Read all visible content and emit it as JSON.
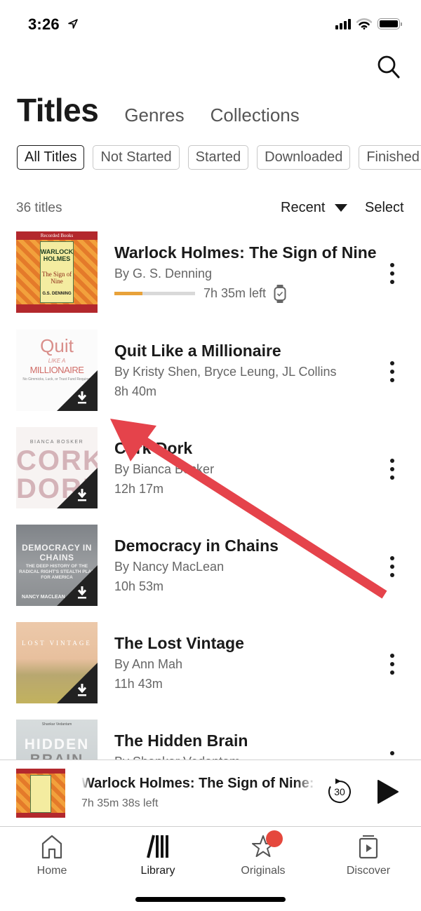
{
  "status_bar": {
    "time": "3:26",
    "icons": [
      "location-arrow-icon",
      "cellular-signal-icon",
      "wifi-icon",
      "battery-icon"
    ]
  },
  "header": {
    "search_icon": "search-icon",
    "tabs": [
      {
        "label": "Titles",
        "active": true
      },
      {
        "label": "Genres",
        "active": false
      },
      {
        "label": "Collections",
        "active": false
      }
    ]
  },
  "filters": [
    {
      "label": "All Titles",
      "active": true
    },
    {
      "label": "Not Started",
      "active": false
    },
    {
      "label": "Started",
      "active": false
    },
    {
      "label": "Downloaded",
      "active": false
    },
    {
      "label": "Finished",
      "active": false
    }
  ],
  "list_meta": {
    "count_label": "36 titles",
    "sort_label": "Recent",
    "select_label": "Select"
  },
  "titles": [
    {
      "title": "Warlock Holmes: The Sign of Nine",
      "author": "By G. S. Denning",
      "progress": 0.35,
      "time_left": "7h 35m left",
      "downloaded": false,
      "watch_synced": true,
      "cover": {
        "publisher": "Recorded Books",
        "line1": "WARLOCK HOLMES",
        "line2": "The Sign of Nine",
        "line3": "G.S. DENNING"
      }
    },
    {
      "title": "Quit Like a Millionaire",
      "author": "By Kristy Shen, Bryce Leung, JL Collins",
      "duration": "8h 40m",
      "downloaded": true,
      "cover": {
        "line1": "Quit",
        "line2": "LIKE A",
        "line3": "MILLIONAIRE",
        "line4": "No Gimmicks, Luck, or Trust Fund Required"
      }
    },
    {
      "title": "Cork Dork",
      "author": "By Bianca Bosker",
      "duration": "12h 17m",
      "downloaded": true,
      "cover": {
        "line1": "BIANCA BOSKER",
        "line2": "CORK DORK"
      }
    },
    {
      "title": "Democracy in Chains",
      "author": "By Nancy MacLean",
      "duration": "10h 53m",
      "downloaded": true,
      "cover": {
        "line1": "DEMOCRACY IN CHAINS",
        "line2": "THE DEEP HISTORY OF THE RADICAL RIGHT'S STEALTH PLAN FOR AMERICA",
        "line3": "NANCY MACLEAN"
      }
    },
    {
      "title": "The Lost Vintage",
      "author": "By Ann Mah",
      "duration": "11h 43m",
      "downloaded": true,
      "cover": {
        "line1": "LOST VINTAGE"
      }
    },
    {
      "title": "The Hidden Brain",
      "author": "By Shankar Vedantam",
      "duration": "",
      "downloaded": false,
      "cover": {
        "line0": "Shankar Vedantam",
        "line1": "HIDDEN",
        "line2": "BRAIN"
      }
    }
  ],
  "mini_player": {
    "title": "Warlock Holmes: The Sign of Nine: Wa",
    "time_left": "7h 35m 38s left",
    "skip_back_seconds": "30"
  },
  "tab_bar": [
    {
      "label": "Home",
      "icon": "home-icon",
      "active": false
    },
    {
      "label": "Library",
      "icon": "library-icon",
      "active": true
    },
    {
      "label": "Originals",
      "icon": "star-icon",
      "active": false,
      "badge": true
    },
    {
      "label": "Discover",
      "icon": "discover-icon",
      "active": false
    }
  ],
  "colors": {
    "progress_fill": "#e8a23a",
    "progress_track": "#d9d9d9",
    "annotation_arrow": "#e5434b",
    "badge": "#e5483d",
    "text_primary": "#1a1a1a",
    "text_secondary": "#666666"
  }
}
